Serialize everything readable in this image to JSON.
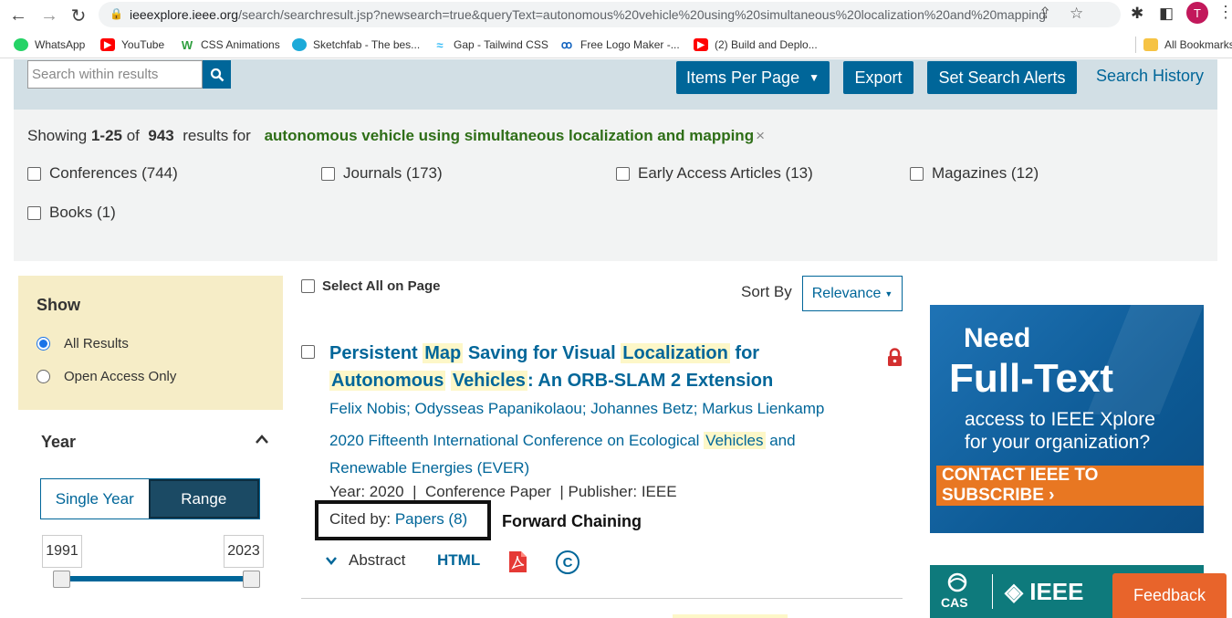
{
  "browser": {
    "url_host": "ieeexplore.ieee.org",
    "url_path": "/search/searchresult.jsp?newsearch=true&queryText=autonomous%20vehicle%20using%20simultaneous%20localization%20and%20mapping",
    "profile_initial": "T",
    "bookmarks": [
      {
        "label": "WhatsApp",
        "icon": "whatsapp-icon",
        "color": "#25d366"
      },
      {
        "label": "YouTube",
        "icon": "youtube-icon",
        "color": "#ff0000"
      },
      {
        "label": "CSS Animations",
        "icon": "w-logo-icon",
        "color": "#2e9e3e"
      },
      {
        "label": "Sketchfab - The bes...",
        "icon": "sketchfab-icon",
        "color": "#1caad9"
      },
      {
        "label": "Gap - Tailwind CSS",
        "icon": "tailwind-icon",
        "color": "#38bdf8"
      },
      {
        "label": "Free Logo Maker -...",
        "icon": "logo-maker-icon",
        "color": "#1565c0"
      },
      {
        "label": "(2) Build and Deplo...",
        "icon": "youtube-icon",
        "color": "#ff0000"
      }
    ],
    "all_bookmarks": "All Bookmarks"
  },
  "toolbar": {
    "search_placeholder": "Search within results",
    "items_per_page": "Items Per Page",
    "export": "Export",
    "set_search_alerts": "Set Search Alerts",
    "search_history": "Search History"
  },
  "summary": {
    "showing": "Showing",
    "range": "1-25",
    "of": "of",
    "total": "943",
    "results_for": "results for",
    "query": "autonomous vehicle using simultaneous localization and mapping",
    "clear": "×"
  },
  "facets": [
    "Conferences (744)",
    "Journals (173)",
    "Early Access Articles (13)",
    "Magazines (12)",
    "Books (1)"
  ],
  "sidebar": {
    "show_title": "Show",
    "options": [
      "All Results",
      "Open Access Only"
    ],
    "selected": "All Results",
    "year_title": "Year",
    "single_year": "Single Year",
    "range": "Range",
    "year_from": "1991",
    "year_to": "2023"
  },
  "list": {
    "select_all": "Select All on Page",
    "sort_by": "Sort By",
    "sort_value": "Relevance"
  },
  "result": {
    "title_parts": [
      "Persistent ",
      "Map",
      " Saving for Visual ",
      "Localization",
      " for ",
      "Autonomous",
      " ",
      "Vehicles",
      ": An ORB-SLAM 2 Extension"
    ],
    "authors": "Felix Nobis; Odysseas Papanikolaou; Johannes Betz; Markus Lienkamp",
    "conf_parts": [
      "2020 Fifteenth International Conference on Ecological ",
      "Vehicles",
      " and Renewable Energies (EVER)"
    ],
    "year": "Year: 2020",
    "type": "Conference Paper",
    "publisher": "Publisher:  IEEE",
    "cited_label": "Cited by:",
    "cited_link": "Papers (8)",
    "annotation": "Forward Chaining",
    "abstract": "Abstract",
    "html": "HTML"
  },
  "ad": {
    "need": "Need",
    "full_text": "Full-Text",
    "line1": "access to IEEE Xplore",
    "line2": "for your organization?",
    "cta": "CONTACT IEEE TO SUBSCRIBE ›"
  },
  "ad2": {
    "cas": "CAS",
    "ieee": "IEEE"
  },
  "feedback": "Feedback"
}
